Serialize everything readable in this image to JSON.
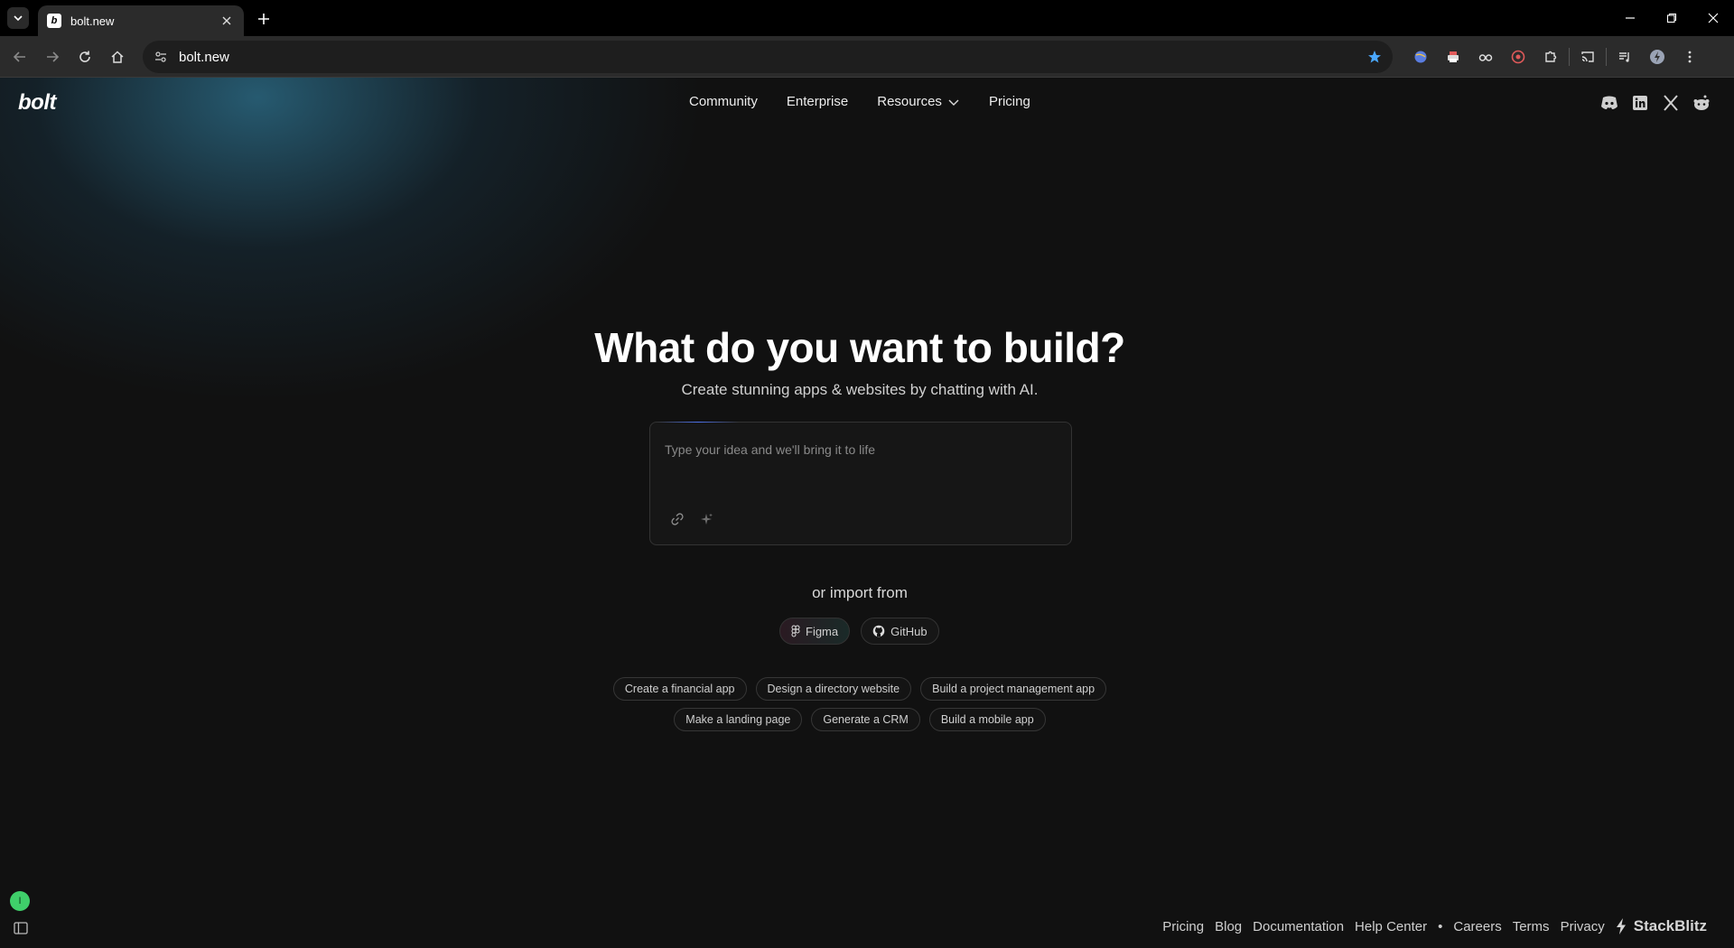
{
  "browser": {
    "tab_title": "bolt.new",
    "favicon_letter": "b",
    "url": "bolt.new"
  },
  "header": {
    "logo": "bolt",
    "nav": [
      {
        "label": "Community"
      },
      {
        "label": "Enterprise"
      },
      {
        "label": "Resources"
      },
      {
        "label": "Pricing"
      }
    ],
    "social": [
      "discord-icon",
      "linkedin-icon",
      "x-icon",
      "reddit-icon"
    ]
  },
  "hero": {
    "title": "What do you want to build?",
    "subtitle": "Create stunning apps & websites by chatting with AI."
  },
  "prompt": {
    "placeholder": "Type your idea and we'll bring it to life",
    "value": ""
  },
  "import": {
    "label": "or import from",
    "sources": [
      {
        "label": "Figma"
      },
      {
        "label": "GitHub"
      }
    ]
  },
  "suggestions": {
    "row1": [
      "Create a financial app",
      "Design a directory website",
      "Build a project management app"
    ],
    "row2": [
      "Make a landing page",
      "Generate a CRM",
      "Build a mobile app"
    ]
  },
  "user": {
    "avatar_initial": "I"
  },
  "footer": {
    "links": [
      "Pricing",
      "Blog",
      "Documentation",
      "Help Center"
    ],
    "separator": "•",
    "links2": [
      "Careers",
      "Terms",
      "Privacy"
    ],
    "brand": "StackBlitz"
  },
  "colors": {
    "background": "#111111",
    "avatar": "#3fcf6a",
    "star": "#4aa8ff"
  }
}
